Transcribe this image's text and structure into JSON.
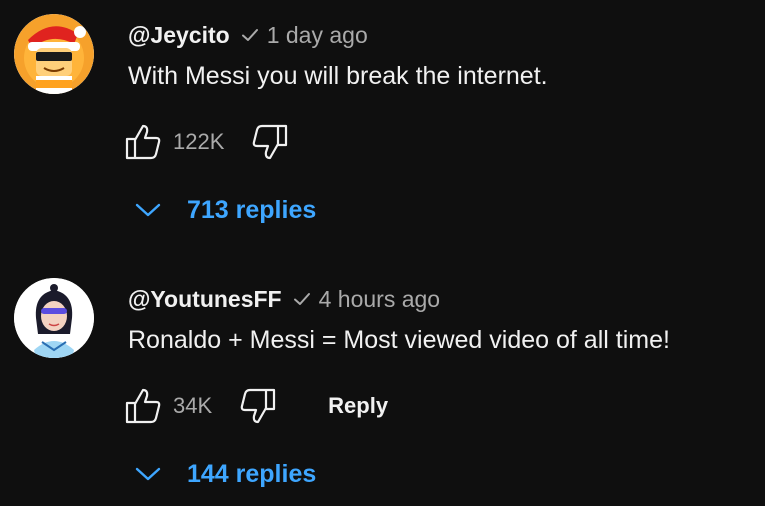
{
  "comments": [
    {
      "author": "@Jeycito",
      "time": "1 day ago",
      "text": "With Messi you will break the internet.",
      "likes": "122K",
      "reply_label": "",
      "replies_label": "713 replies"
    },
    {
      "author": "@YoutunesFF",
      "time": "4 hours ago",
      "text": "Ronaldo + Messi = Most viewed video of all time!",
      "likes": "34K",
      "reply_label": "Reply",
      "replies_label": "144 replies"
    }
  ],
  "colors": {
    "background": "#0f0f0f",
    "text": "#f1f1f1",
    "muted": "#aaaaaa",
    "link": "#3ea6ff"
  },
  "icons": [
    "verified-check-icon",
    "thumbs-up-icon",
    "thumbs-down-icon",
    "chevron-down-icon"
  ]
}
